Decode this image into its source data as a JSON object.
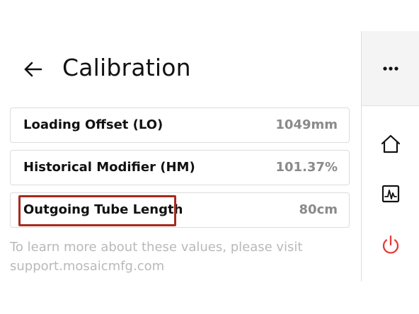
{
  "header": {
    "title": "Calibration",
    "back_icon": "arrow-left-icon"
  },
  "settings": [
    {
      "label": "Loading Offset (LO)",
      "value": "1049mm"
    },
    {
      "label": "Historical Modifier (HM)",
      "value": "101.37%"
    },
    {
      "label": "Outgoing Tube Length",
      "value": "80cm",
      "highlighted": true
    }
  ],
  "help": {
    "text": "To learn more about these values, please visit support.mosaicmfg.com"
  },
  "sidebar": {
    "menu_icon": "more-horizontal-icon",
    "items": [
      {
        "icon": "home-icon"
      },
      {
        "icon": "activity-chart-icon"
      },
      {
        "icon": "power-icon",
        "color": "#e53935"
      }
    ]
  },
  "colors": {
    "highlight_border": "#a62a1e",
    "value_text": "#8a8a8a",
    "help_text": "#b9b9b9",
    "power": "#e53935"
  }
}
